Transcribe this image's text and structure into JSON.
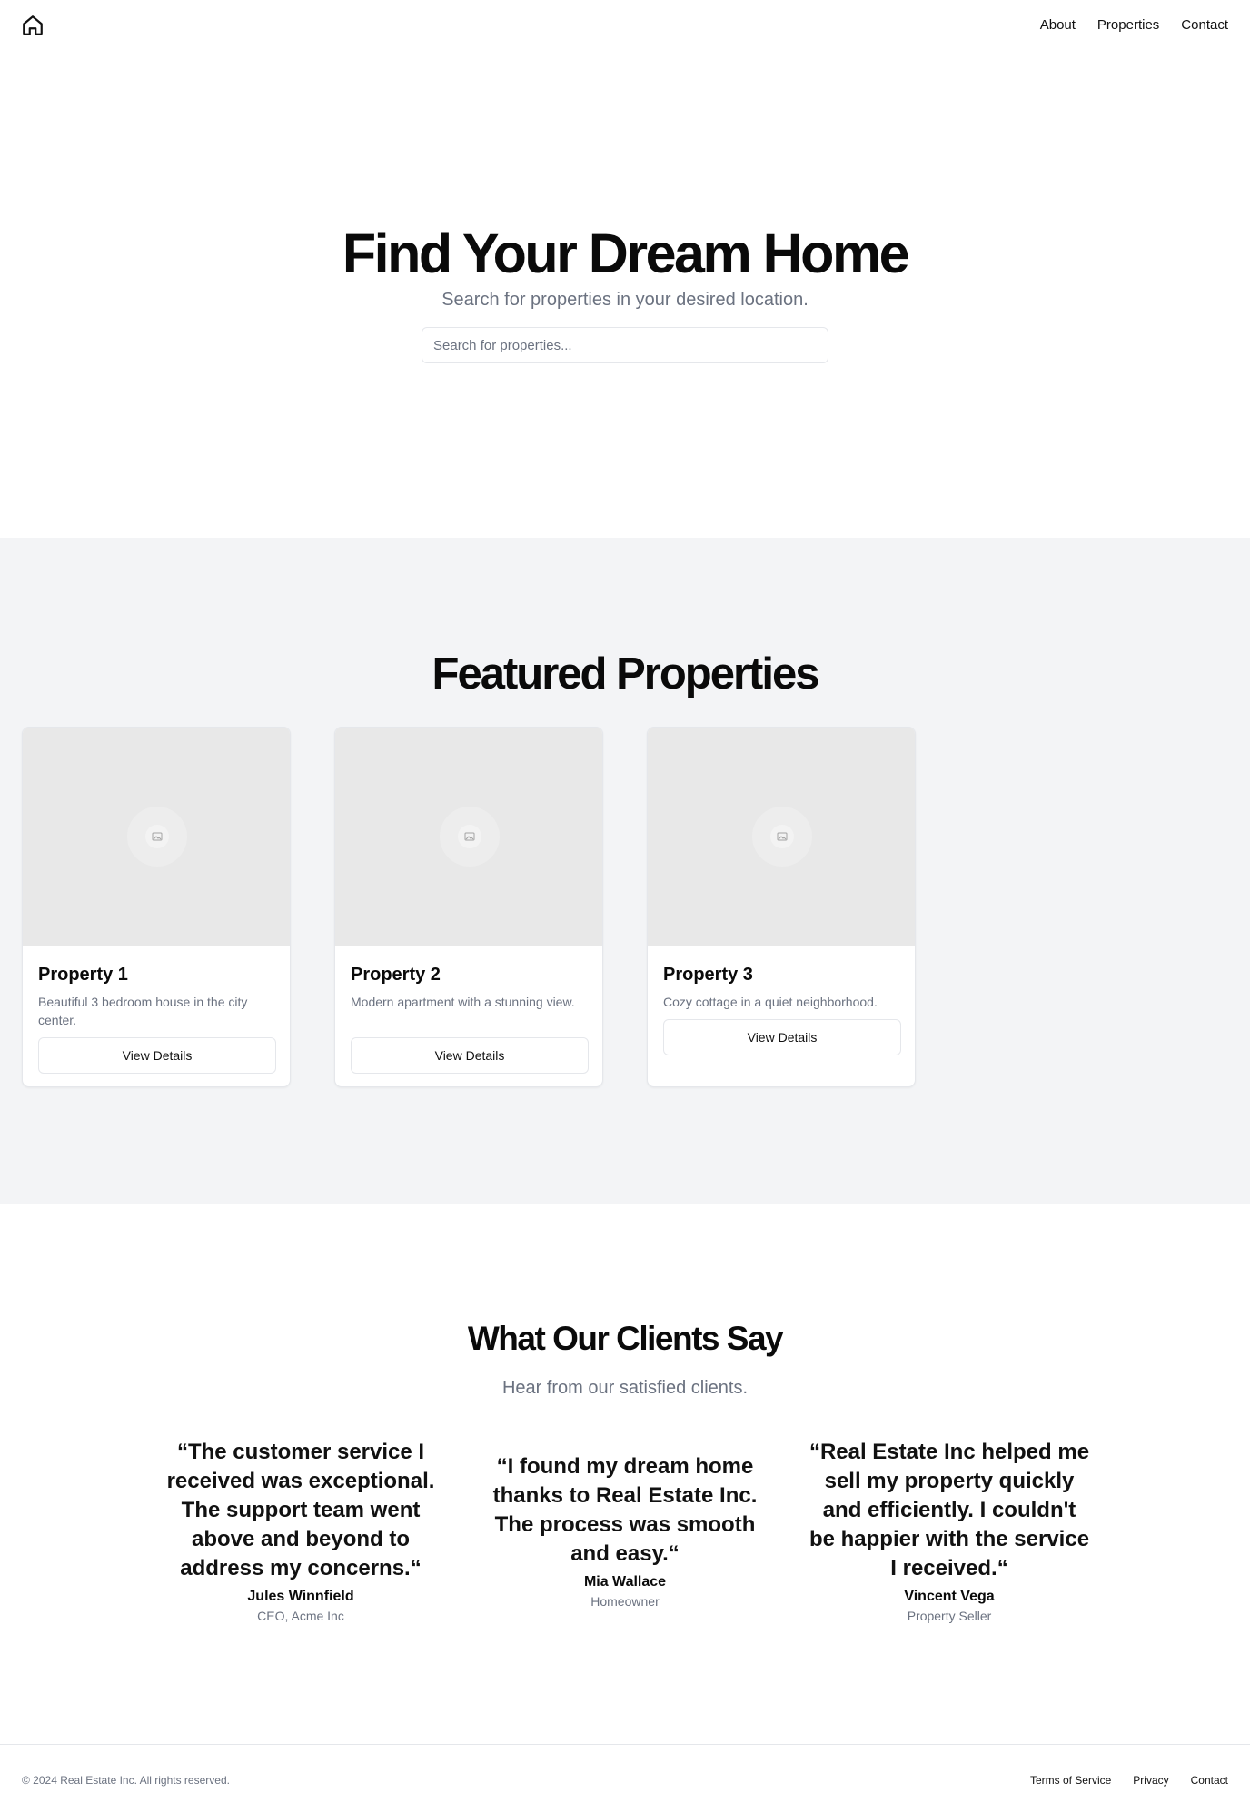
{
  "header": {
    "logo_icon": "home-icon",
    "nav": [
      "About",
      "Properties",
      "Contact"
    ]
  },
  "hero": {
    "title": "Find Your Dream Home",
    "subtitle": "Search for properties in your desired location.",
    "search_placeholder": "Search for properties...",
    "search_value": ""
  },
  "featured": {
    "title": "Featured Properties",
    "image_icon": "image-placeholder-icon",
    "properties": [
      {
        "title": "Property 1",
        "description": "Beautiful 3 bedroom house in the city center.",
        "button": "View Details"
      },
      {
        "title": "Property 2",
        "description": "Modern apartment with a stunning view.",
        "button": "View Details"
      },
      {
        "title": "Property 3",
        "description": "Cozy cottage in a quiet neighborhood.",
        "button": "View Details"
      }
    ]
  },
  "testimonials": {
    "title": "What Our Clients Say",
    "subtitle": "Hear from our satisfied clients.",
    "items": [
      {
        "quote": "“The customer service I received was exceptional. The support team went above and beyond to address my concerns.“",
        "name": "Jules Winnfield",
        "role": "CEO, Acme Inc"
      },
      {
        "quote": "“I found my dream home thanks to Real Estate Inc. The process was smooth and easy.“",
        "name": "Mia Wallace",
        "role": "Homeowner"
      },
      {
        "quote": "“Real Estate Inc helped me sell my property quickly and efficiently. I couldn't be happier with the service I received.“",
        "name": "Vincent Vega",
        "role": "Property Seller"
      }
    ]
  },
  "footer": {
    "copyright": "© 2024 Real Estate Inc. All rights reserved.",
    "links": [
      "Terms of Service",
      "Privacy",
      "Contact"
    ]
  },
  "colors": {
    "text": "#0a0a0a",
    "muted": "#6b7280",
    "section_bg": "#f3f4f6",
    "border": "#e5e7eb",
    "image_placeholder": "#e8e8e8"
  }
}
